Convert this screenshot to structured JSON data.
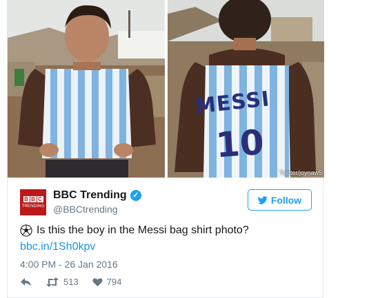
{
  "photo_credit": "Twitter/joynaw5",
  "photo_jersey_name": "MESSI",
  "photo_jersey_number": "10",
  "account": {
    "logo_letters": [
      "B",
      "B",
      "C"
    ],
    "logo_word": "TRENDING",
    "display_name": "BBC Trending",
    "verified_glyph": "✓",
    "handle": "@BBCtrending"
  },
  "follow_label": "Follow",
  "tweet": {
    "text": "Is this the boy in the Messi bag shirt photo?",
    "link": "bbc.in/1Sh0kpv",
    "timestamp": "4:00 PM - 26 Jan 2016"
  },
  "actions": {
    "retweet_count": "513",
    "like_count": "794"
  },
  "colors": {
    "accent": "#1da1f2",
    "link": "#1b95e0",
    "muted": "#657786",
    "brand_red": "#bb1919"
  },
  "icons": [
    "soccer-ball-icon",
    "verified-icon",
    "twitter-bird-icon",
    "reply-icon",
    "retweet-icon",
    "heart-icon"
  ]
}
